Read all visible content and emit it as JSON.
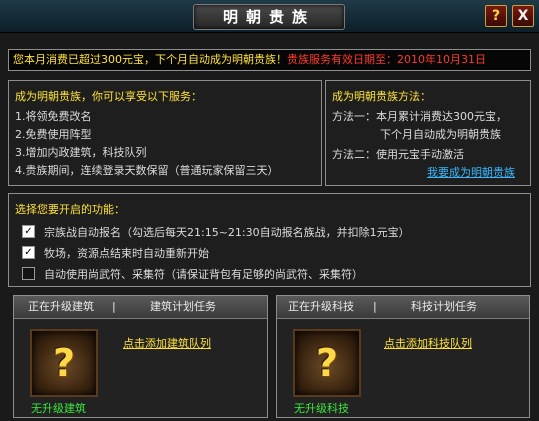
{
  "window": {
    "title": "明朝贵族",
    "help_glyph": "?",
    "close_glyph": "X"
  },
  "notice": {
    "text": "您本月消费已超过300元宝，下个月自动成为明朝贵族！",
    "expiry": "贵族服务有效日期至：2010年10月31日"
  },
  "services": {
    "title": "成为明朝贵族，你可以享受以下服务：",
    "items": [
      "1.将领免费改名",
      "2.免费使用阵型",
      "3.增加内政建筑，科技队列",
      "4.贵族期间，连续登录天数保留（普通玩家保留三天）"
    ]
  },
  "methods": {
    "title": "成为明朝贵族方法：",
    "method1_line1": "方法一：本月累计消费达300元宝，",
    "method1_line2": "下个月自动成为明朝贵族",
    "method2": "方法二：使用元宝手动激活",
    "link": "我要成为明朝贵族"
  },
  "options": {
    "title": "选择您要开启的功能：",
    "items": [
      {
        "label": "宗族战自动报名（勾选后每天21:15~21:30自动报名族战，并扣除1元宝）",
        "checked": true
      },
      {
        "label": "牧场，资源点结束时自动重新开始",
        "checked": true
      },
      {
        "label": "自动使用尚武符、采集符（请保证背包有足够的尚武符、采集符）",
        "checked": false
      }
    ]
  },
  "building": {
    "tab1": "正在升级建筑",
    "separator": "|",
    "tab2": "建筑计划任务",
    "add_link": "点击添加建筑队列",
    "status": "无升级建筑",
    "icon_glyph": "?"
  },
  "tech": {
    "tab1": "正在升级科技",
    "separator": "|",
    "tab2": "科技计划任务",
    "add_link": "点击添加科技队列",
    "status": "无升级科技",
    "icon_glyph": "?"
  }
}
